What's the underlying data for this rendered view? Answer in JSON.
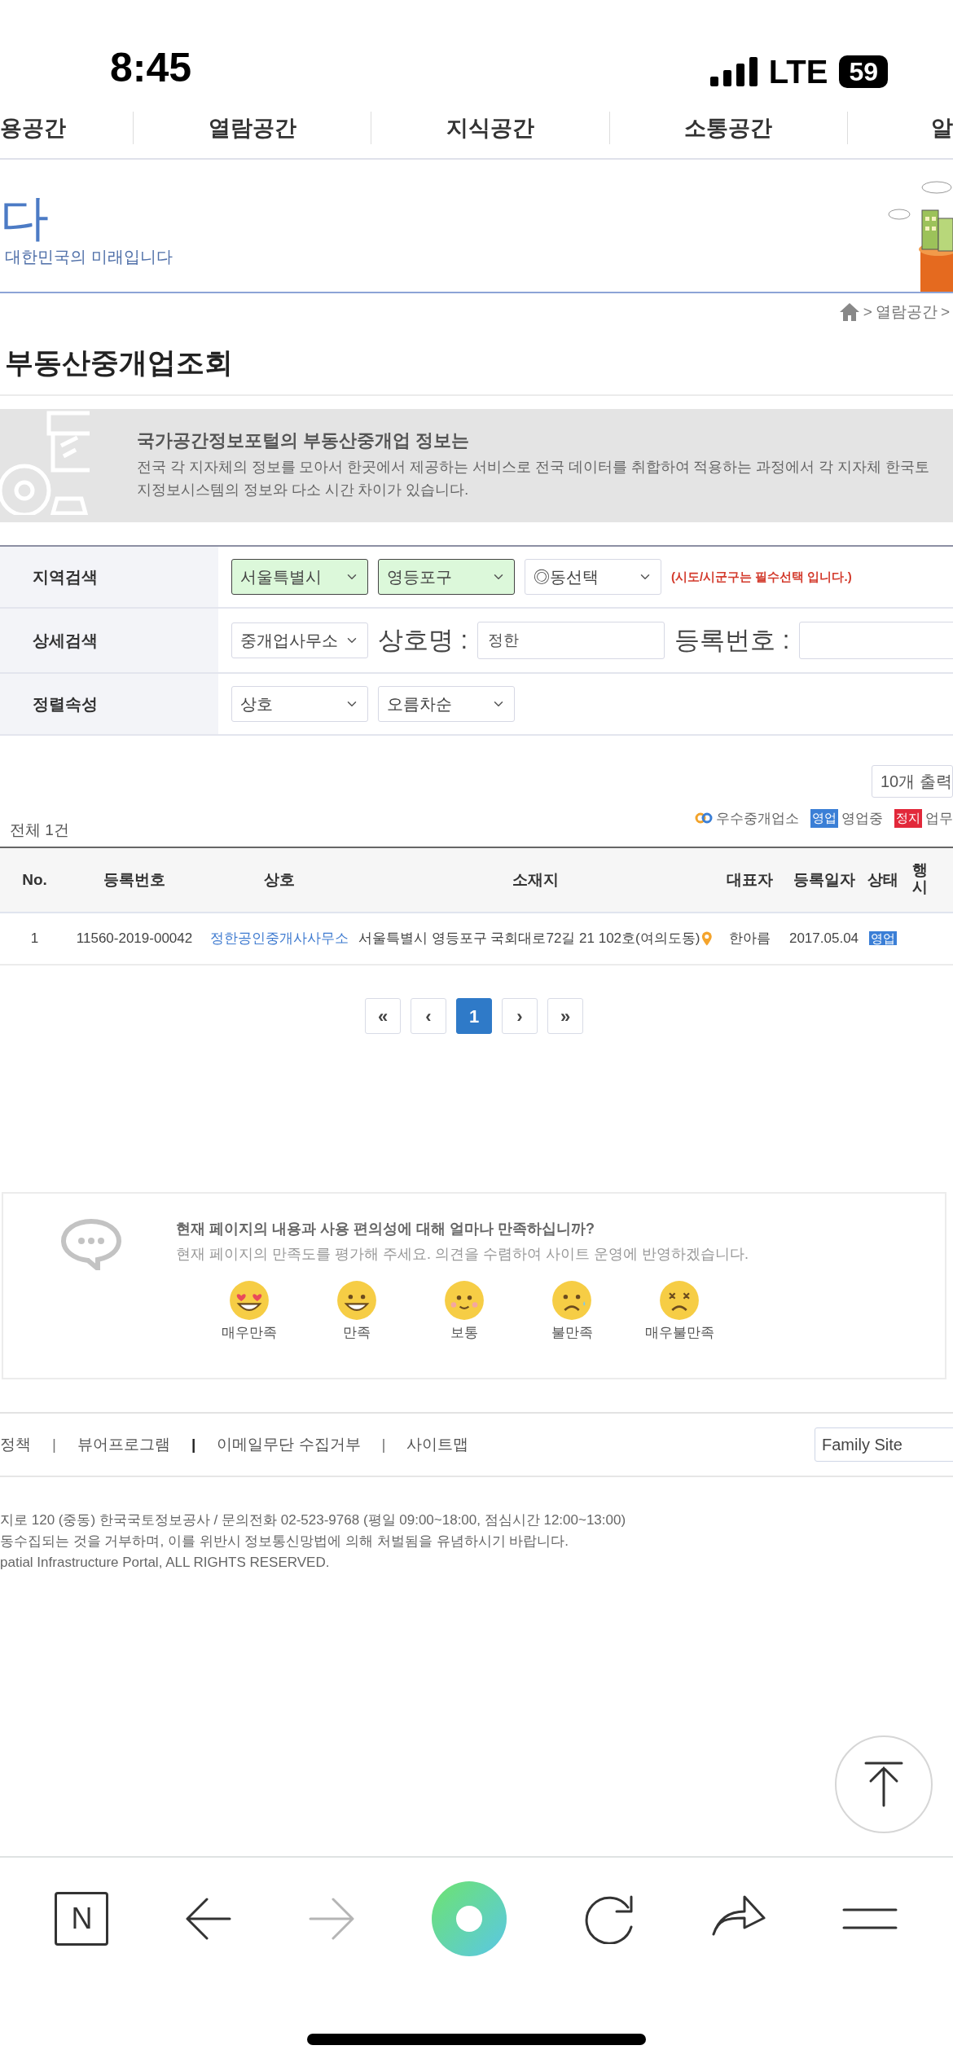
{
  "status_bar": {
    "time": "8:45",
    "network": "LTE",
    "battery": "59"
  },
  "nav": [
    "용공간",
    "열람공간",
    "지식공간",
    "소통공간",
    "알"
  ],
  "hero": {
    "title": "다",
    "subtitle": "대한민국의 미래입니다"
  },
  "breadcrumb": {
    "separator": ">",
    "items": [
      "열람공간"
    ]
  },
  "page_title": "부동산중개업조회",
  "banner": {
    "title": "국가공간정보포털의 부동산중개업 정보는",
    "lines": [
      "전국 각 지자체의 정보를 모아서 한곳에서 제공하는 서비스로 전국 데이터를 취합하여 적용하는 과정에서 각 지자체 한국토",
      "지정보시스템의 정보와 다소 시간 차이가 있습니다."
    ]
  },
  "search": [
    {
      "label": "지역검색",
      "controls": [
        {
          "kind": "select",
          "value": "서울특별시",
          "highlighted": true
        },
        {
          "kind": "select",
          "value": "영등포구",
          "highlighted": true
        },
        {
          "kind": "select",
          "value": "◎동선택",
          "highlighted": false
        },
        {
          "kind": "note",
          "text": "(시도/시군구는 필수선택 입니다.)"
        }
      ]
    },
    {
      "label": "상세검색",
      "controls": [
        {
          "kind": "select",
          "value": "중개업사무소",
          "highlighted": false
        },
        {
          "kind": "label",
          "text": "상호명 :"
        },
        {
          "kind": "input",
          "value": "정한"
        },
        {
          "kind": "label",
          "text": "등록번호 :"
        },
        {
          "kind": "input"
        }
      ]
    },
    {
      "label": "정렬속성",
      "controls": [
        {
          "kind": "select",
          "value": "상호",
          "highlighted": false
        },
        {
          "kind": "select",
          "value": "오름차순",
          "highlighted": false
        }
      ]
    }
  ],
  "per_page": "10개 출력",
  "total": "전체 1건",
  "legend": [
    {
      "kind": "icon",
      "label": "우수중개업소"
    },
    {
      "kind": "badge",
      "badge": "영업",
      "label": "영업중",
      "color": "#3b7fd6"
    },
    {
      "kind": "badge",
      "badge": "정지",
      "label": "업무",
      "color": "#e2283a"
    }
  ],
  "table": {
    "columns": [
      "No.",
      "등록번호",
      "상호",
      "소재지",
      "대표자",
      "등록일자",
      "상태",
      "행시"
    ],
    "rows": [
      {
        "no": "1",
        "reg_no": "11560-2019-00042",
        "name": "정한공인중개사사무소",
        "address": "서울특별시 영등포구 국회대로72길 21 102호(여의도동)",
        "owner": "한아름",
        "date": "2017.05.04",
        "status": {
          "badge": "영업",
          "color": "#3b7fd6"
        }
      }
    ]
  },
  "pagination": [
    {
      "label": "«",
      "selected": false
    },
    {
      "label": "‹",
      "selected": false
    },
    {
      "label": "1",
      "selected": true
    },
    {
      "label": "›",
      "selected": false
    },
    {
      "label": "»",
      "selected": false
    }
  ],
  "survey": {
    "question": "현재 페이지의 내용과 사용 편의성에 대해 얼마나 만족하십니까?",
    "hint": "현재 페이지의 만족도를 평가해 주세요. 의견을 수렴하여 사이트 운영에 반영하겠습니다.",
    "options": [
      {
        "kind": "love",
        "label": "매우만족"
      },
      {
        "kind": "happy",
        "label": "만족"
      },
      {
        "kind": "neutral",
        "label": "보통"
      },
      {
        "kind": "sad",
        "label": "불만족"
      },
      {
        "kind": "dizzy",
        "label": "매우불만족"
      }
    ]
  },
  "footer": {
    "links": [
      {
        "kind": "link",
        "text": "정책"
      },
      {
        "kind": "separator",
        "text": "|",
        "bold": false
      },
      {
        "kind": "link",
        "text": "뷰어프로그램"
      },
      {
        "kind": "separator",
        "text": "|",
        "bold": true
      },
      {
        "kind": "link",
        "text": "이메일무단 수집거부"
      },
      {
        "kind": "separator",
        "text": "|",
        "bold": false
      },
      {
        "kind": "link",
        "text": "사이트맵"
      }
    ],
    "family_site": "Family Site",
    "address": [
      "지로 120 (중동) 한국국토정보공사 / 문의전화 02-523-9768 (평일 09:00~18:00, 점심시간 12:00~13:00)",
      "동수집되는 것을 거부하며, 이를 위반시 정보통신망법에 의해 처벌됨을 유념하시기 바랍니다.",
      "patial Infrastructure Portal, ALL RIGHTS RESERVED."
    ]
  },
  "browser": {
    "tabs_label": "N",
    "forward_disabled": true
  }
}
